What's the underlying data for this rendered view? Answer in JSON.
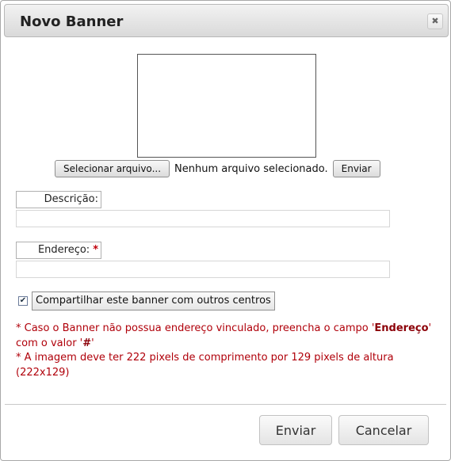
{
  "dialog": {
    "title": "Novo Banner",
    "close_glyph": "✖"
  },
  "upload": {
    "select_button": "Selecionar arquivo...",
    "status": "Nenhum arquivo selecionado.",
    "send_button": "Enviar"
  },
  "form": {
    "description_label": "Descrição:",
    "address_label": "Endereço:",
    "required_mark": "*",
    "share_label": "Compartilhar este banner com outros centros",
    "share_checked": true
  },
  "notes": {
    "line1_a": "* Caso o Banner não possua endereço vinculado, preencha o campo '",
    "line1_field": "Endereço",
    "line1_b": "' com o valor '",
    "line1_value": "#",
    "line1_c": "'",
    "line2": "* A imagem deve ter 222 pixels de comprimento por 129 pixels de altura (222x129)"
  },
  "footer": {
    "submit_button": "Enviar",
    "cancel_button": "Cancelar"
  }
}
